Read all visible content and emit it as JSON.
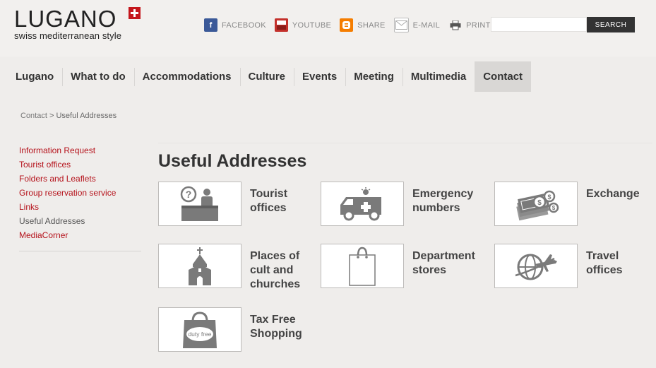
{
  "header": {
    "logo_text": "LUGANO",
    "logo_tagline": "swiss mediterranean style",
    "social": [
      {
        "label": "FACEBOOK",
        "icon": "facebook-icon"
      },
      {
        "label": "YOUTUBE",
        "icon": "youtube-icon"
      },
      {
        "label": "SHARE",
        "icon": "share-icon"
      },
      {
        "label": "E-MAIL",
        "icon": "email-icon"
      },
      {
        "label": "PRINT",
        "icon": "print-icon"
      }
    ],
    "search": {
      "placeholder": "",
      "value": "",
      "button_label": "SEARCH"
    }
  },
  "nav": {
    "items": [
      {
        "label": "Lugano"
      },
      {
        "label": "What to do"
      },
      {
        "label": "Accommodations"
      },
      {
        "label": "Culture"
      },
      {
        "label": "Events"
      },
      {
        "label": "Meeting"
      },
      {
        "label": "Multimedia"
      },
      {
        "label": "Contact",
        "active": true
      }
    ]
  },
  "breadcrumb": {
    "parent": "Contact",
    "separator": " > ",
    "current": "Useful Addresses"
  },
  "sidebar": {
    "links": [
      {
        "label": "Information Request"
      },
      {
        "label": "Tourist offices"
      },
      {
        "label": "Folders and Leaflets"
      },
      {
        "label": "Group reservation service"
      },
      {
        "label": "Links"
      },
      {
        "label": "Useful Addresses",
        "current": true
      },
      {
        "label": "MediaCorner"
      }
    ]
  },
  "main": {
    "title": "Useful Addresses",
    "tiles": [
      {
        "label": "Tourist\noffices",
        "icon": "tourist-desk-icon"
      },
      {
        "label": "Emergency\nnumbers",
        "icon": "ambulance-icon"
      },
      {
        "label": "Exchange",
        "icon": "money-exchange-icon"
      },
      {
        "label": "Places of\ncult and\nchurches",
        "icon": "church-icon"
      },
      {
        "label": "Department\nstores",
        "icon": "shopping-bag-icon"
      },
      {
        "label": "Travel\noffices",
        "icon": "globe-plane-icon"
      },
      {
        "label": "Tax Free\nShopping",
        "icon": "duty-free-bag-icon",
        "icon_text": "duty free"
      }
    ]
  },
  "colors": {
    "brand_red": "#c4161c",
    "link_red": "#b5121b",
    "background": "#efedeb",
    "icon_gray": "#7a7a7a"
  }
}
